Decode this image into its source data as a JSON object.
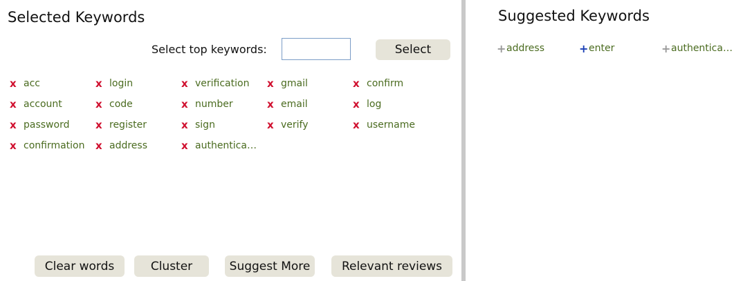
{
  "left": {
    "title": "Selected Keywords",
    "top_label": "Select top keywords:",
    "top_input_value": "",
    "select_button": "Select",
    "keywords": [
      [
        "acc",
        "login",
        "verification",
        "gmail",
        "confirm"
      ],
      [
        "account",
        "code",
        "number",
        "email",
        "log"
      ],
      [
        "password",
        "register",
        "sign",
        "verify",
        "username"
      ],
      [
        "confirmation",
        "address",
        "authentica…"
      ]
    ],
    "remove_glyph": "x",
    "buttons": [
      "Clear words",
      "Cluster",
      "Suggest More",
      "Relevant reviews"
    ]
  },
  "right": {
    "title": "Suggested Keywords",
    "suggestions": [
      {
        "word": "address",
        "plus_color": "#9a9a9a"
      },
      {
        "word": "enter",
        "plus_color": "#1a3fb5"
      },
      {
        "word": "authentica…",
        "plus_color": "#9a9a9a"
      }
    ],
    "plus_glyph": "+"
  }
}
